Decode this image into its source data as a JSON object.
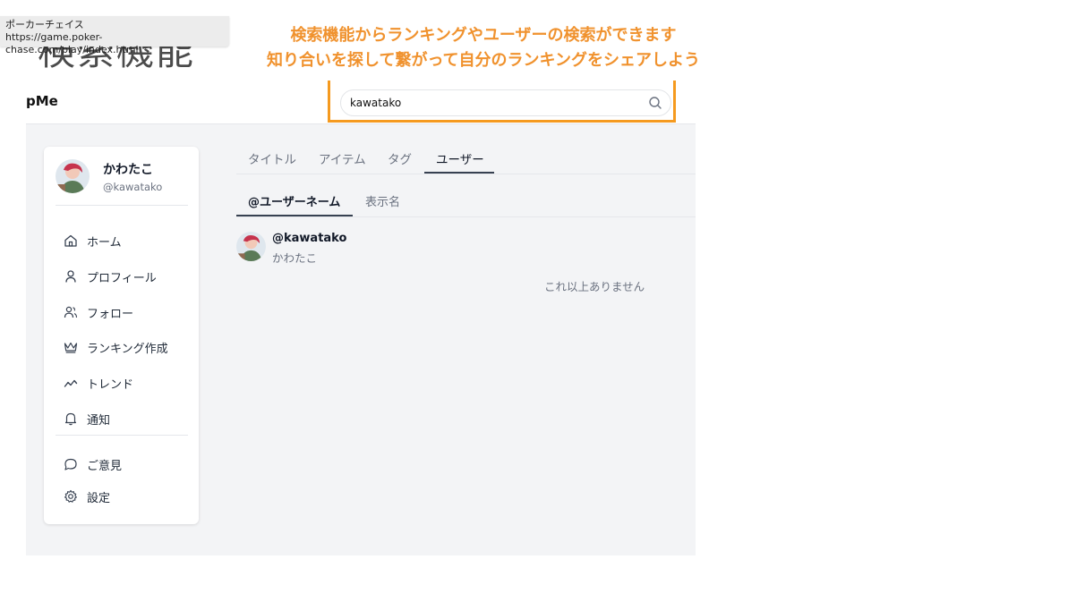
{
  "slide": {
    "title": "検索機能",
    "caption_line1": "検索機能からランキングやユーザーの検索ができます",
    "caption_line2": "知り合いを探して繋がって自分のランキングをシェアしよう"
  },
  "tooltip": {
    "title": "ポーカーチェイス",
    "url": "https://game.poker-chase.com/play/index.html"
  },
  "header": {
    "brand": "pMe",
    "search_value": "kawatako",
    "search_icon": "search-icon"
  },
  "profile": {
    "name": "かわたこ",
    "handle": "@kawatako"
  },
  "sidebar": {
    "items": [
      {
        "label": "ホーム",
        "icon": "home-icon"
      },
      {
        "label": "プロフィール",
        "icon": "user-icon"
      },
      {
        "label": "フォロー",
        "icon": "users-icon"
      },
      {
        "label": "ランキング作成",
        "icon": "crown-icon"
      },
      {
        "label": "トレンド",
        "icon": "trend-icon"
      },
      {
        "label": "通知",
        "icon": "bell-icon"
      }
    ],
    "footer_items": [
      {
        "label": "ご意見",
        "icon": "message-icon"
      },
      {
        "label": "設定",
        "icon": "gear-icon"
      }
    ]
  },
  "tabs": [
    {
      "label": "タイトル"
    },
    {
      "label": "アイテム"
    },
    {
      "label": "タグ"
    },
    {
      "label": "ユーザー",
      "active": true
    }
  ],
  "subtabs": [
    {
      "label": "@ユーザーネーム",
      "active": true
    },
    {
      "label": "表示名"
    }
  ],
  "results": [
    {
      "handle": "@kawatako",
      "name": "かわたこ"
    }
  ],
  "no_more_text": "これ以上ありません",
  "colors": {
    "accent_orange": "#f0922e",
    "highlight_border": "#f59a1f",
    "content_bg": "#f3f4f6"
  }
}
